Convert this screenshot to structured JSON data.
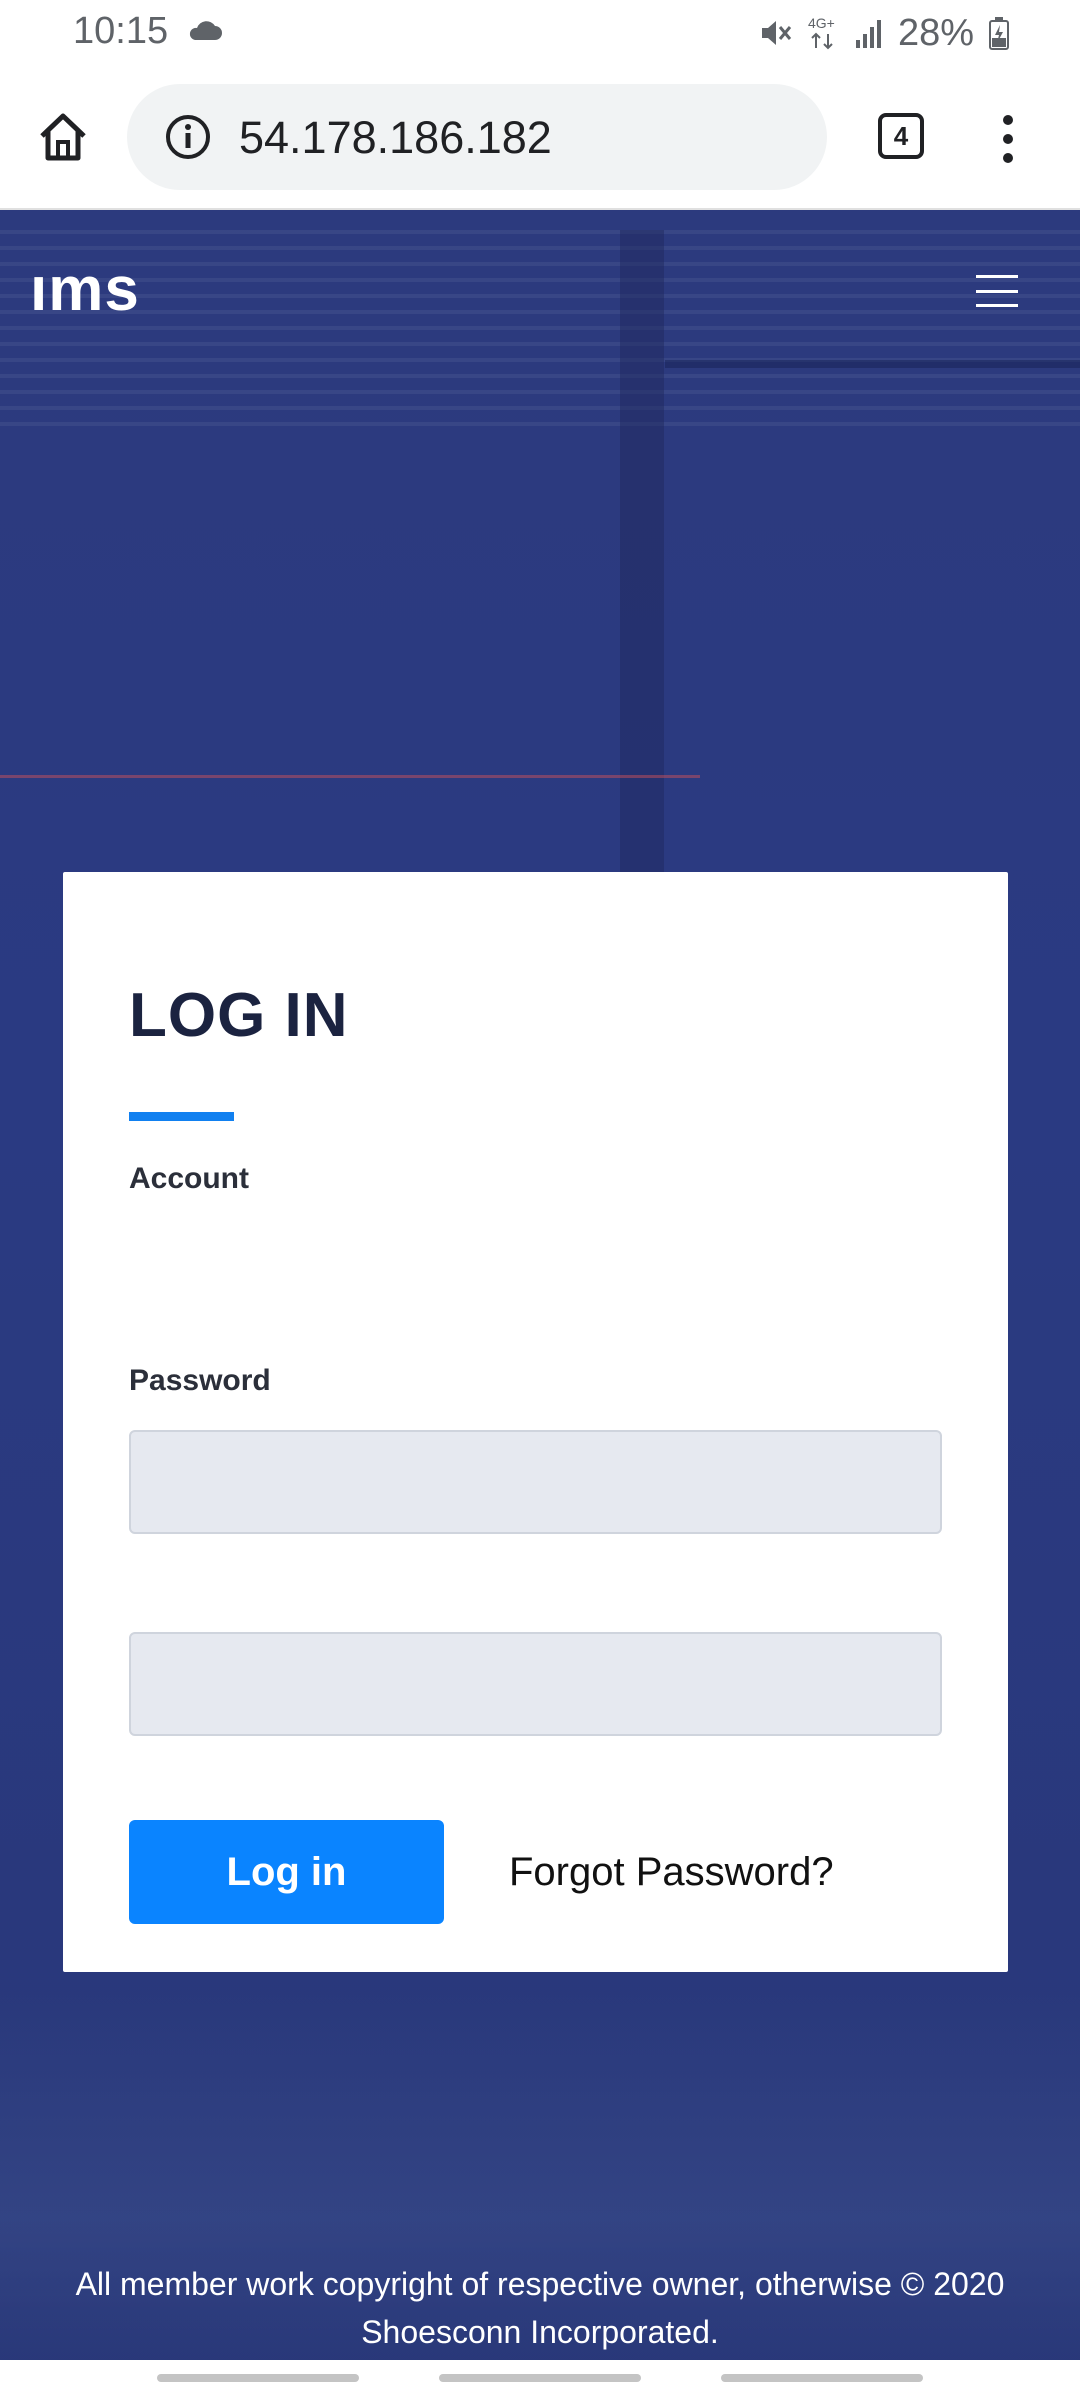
{
  "status_bar": {
    "time": "10:15",
    "battery": "28%",
    "icons": [
      "cloud-icon",
      "mute-icon",
      "4g-icon",
      "signal-icon",
      "battery-icon"
    ]
  },
  "browser": {
    "url": "54.178.186.182",
    "tab_count": "4",
    "icons": [
      "home-icon",
      "info-icon",
      "tabs-icon",
      "more-vert-icon"
    ]
  },
  "header": {
    "logo_text": "ıms",
    "menu_icon": "hamburger-icon"
  },
  "login": {
    "title": "LOG IN",
    "account_label": "Account",
    "account_value": "",
    "password_label": "Password",
    "password_value": "",
    "login_button": "Log in",
    "forgot_link": "Forgot Password?"
  },
  "footer": {
    "line1": "All member work copyright of respective owner, otherwise © 2020",
    "line2": "Shoesconn Incorporated."
  },
  "colors": {
    "accent": "#0a84ff",
    "title": "#1b2340",
    "background": "#2e3d84"
  }
}
